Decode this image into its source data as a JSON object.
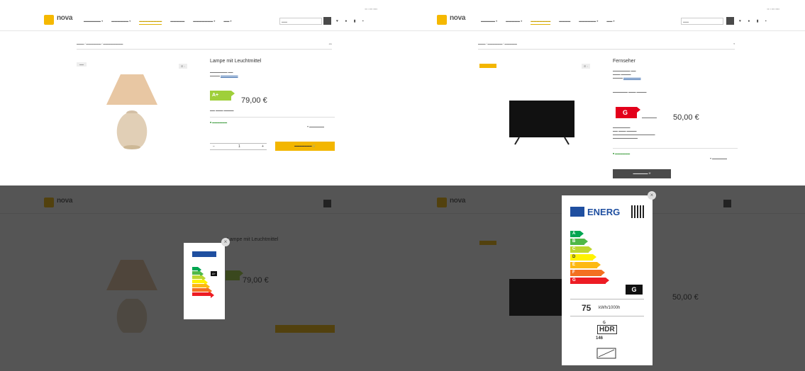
{
  "colors": {
    "accent": "#f3b600",
    "energy_a_plus": "#9fcf3a",
    "energy_g": "#e3001b",
    "dark": "#4a4a4a"
  },
  "product_lamp": {
    "title": "Lampe mit Leuchtmittel",
    "price": "79,00 €",
    "energy_class": "A+",
    "quantity": "1",
    "qty_minus": "−",
    "qty_plus": "+",
    "cart_icon": "cart-icon"
  },
  "product_tv": {
    "title": "Fernseher",
    "price": "50,00 €",
    "energy_class": "G"
  },
  "label_tv": {
    "header": "ENERG",
    "scale": [
      "A",
      "B",
      "C",
      "D",
      "E",
      "F",
      "G"
    ],
    "class": "G",
    "consumption_value": "75",
    "consumption_unit": "kWh/1000h",
    "sdr_class": "G",
    "hdr_text": "HDR",
    "hdr_value": "146"
  },
  "label_lamp": {
    "class": "A+"
  }
}
